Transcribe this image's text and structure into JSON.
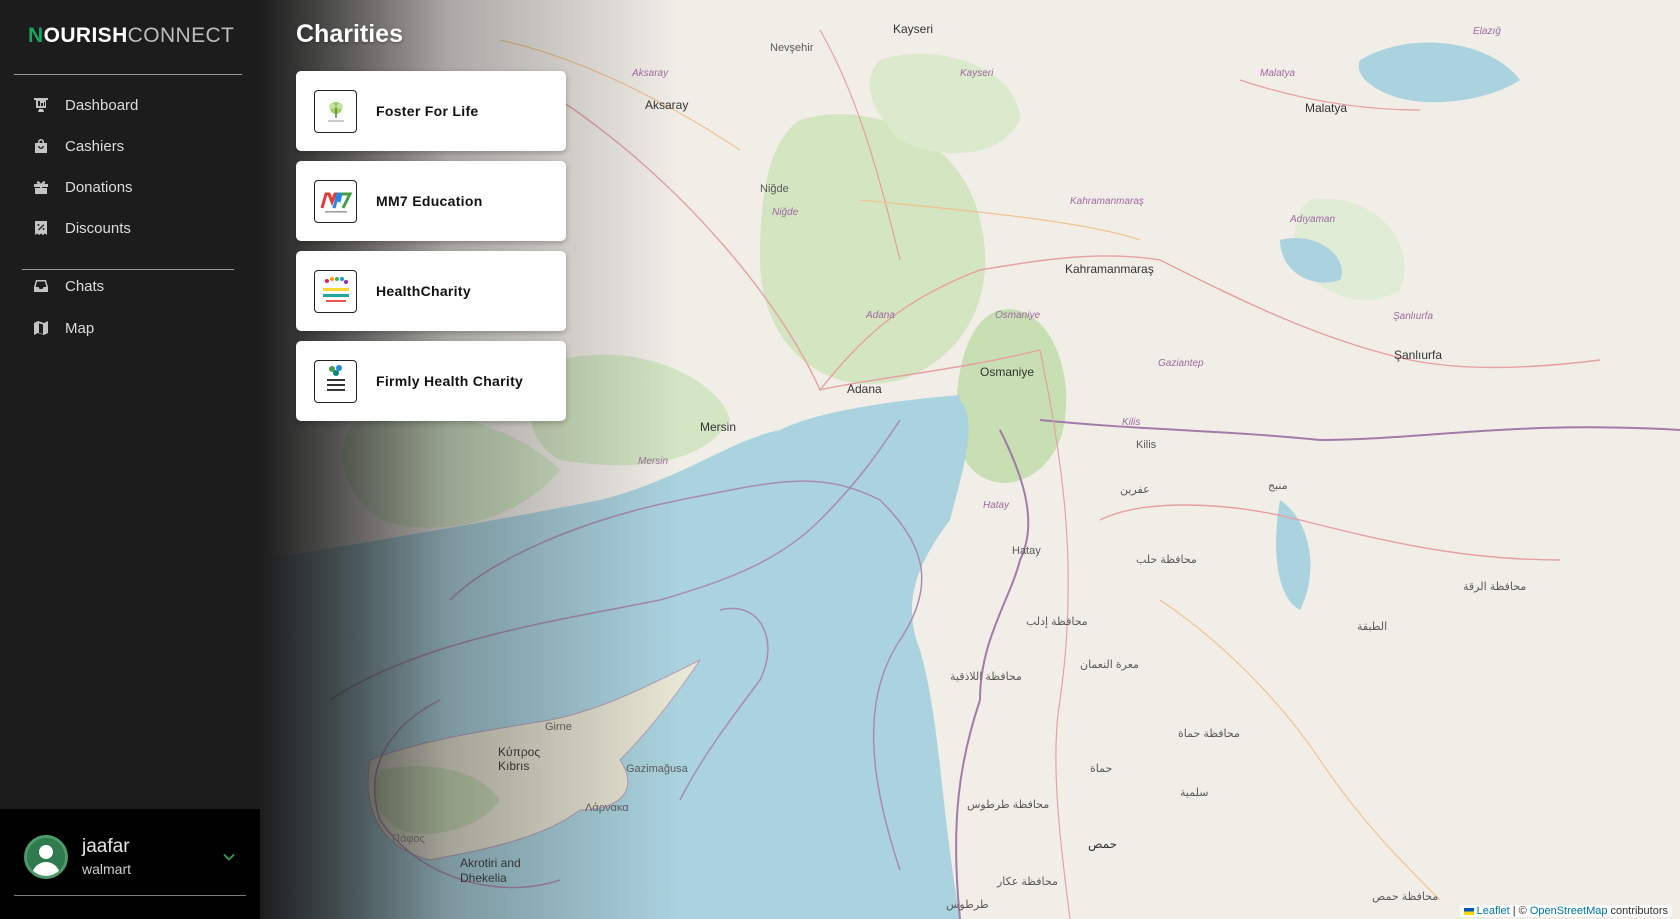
{
  "brand": {
    "first_letter": "N",
    "bold_part": "OURISH",
    "light_part": "CONNECT"
  },
  "sidebar": {
    "items": [
      {
        "label": "Dashboard",
        "icon": "dashboard-icon"
      },
      {
        "label": "Cashiers",
        "icon": "shopping-bag-icon"
      },
      {
        "label": "Donations",
        "icon": "gift-icon"
      },
      {
        "label": "Discounts",
        "icon": "receipt-percent-icon"
      },
      {
        "label": "Chats",
        "icon": "inbox-icon"
      },
      {
        "label": "Map",
        "icon": "map-icon"
      }
    ]
  },
  "user": {
    "name": "jaafar",
    "org": "walmart",
    "avatar_icon": "user-avatar-icon",
    "menu_icon": "chevron-down-icon"
  },
  "page": {
    "title": "Charities"
  },
  "charities": [
    {
      "name": "Foster For Life",
      "logo": "foster-for-life-logo"
    },
    {
      "name": "MM7 Education",
      "logo": "mm7-education-logo"
    },
    {
      "name": "HealthCharity",
      "logo": "healthcharity-logo"
    },
    {
      "name": "Firmly Health Charity",
      "logo": "firmly-health-charity-logo"
    }
  ],
  "map": {
    "labels": {
      "kayseri": "Kayseri",
      "kayseri_region": "Kayseri",
      "nevsehir": "Nevşehir",
      "aksaray": "Aksaray",
      "aksaray_region": "Aksaray",
      "nigde": "Niğde",
      "nigde_region": "Niğde",
      "malatya": "Malatya",
      "malatya_region": "Malatya",
      "elazig": "Elazığ",
      "kahramanmaras": "Kahramanmaraş",
      "kahramanmaras_region": "Kahramanmaraş",
      "adiyaman": "Adıyaman",
      "adana": "Adana",
      "adana_region": "Adana",
      "osmaniye": "Osmaniye",
      "osmaniye_region": "Osmaniye",
      "gaziantep": "Gaziantep",
      "sanliurfa": "Şanlıurfa",
      "sanliurfa_region": "Şanlıurfa",
      "mersin": "Mersin",
      "mersin_region": "Mersin",
      "kilis": "Kilis",
      "kilis_region": "Kilis",
      "hatay": "Hatay",
      "hatay_region": "Hatay",
      "girne": "Girne",
      "kibris": "Κύπρος\nKıbrıs",
      "gazimagusa": "Gazimağusa",
      "larnaka": "Λάρνακα",
      "pafos": "Πάφος",
      "akrotiri": "Akrotiri and\nDhekelia",
      "afrin": "عفرين",
      "manbij": "منبج",
      "aleppo": "محافظة حلب",
      "idlib": "محافظة إدلب",
      "maarat": "معرة النعمان",
      "latakia": "محافظة اللاذقية",
      "hama": "حماة",
      "hama_region": "محافظة حماة",
      "salamiyah": "سلمية",
      "tartus": "محافظة طرطوس",
      "homs": "حمص",
      "homs_region": "محافظة حمص",
      "raqqa": "محافظة الرقة",
      "tabqa": "الطبقة",
      "akkar": "محافظة عكار",
      "tartus_city": "طرطوس"
    }
  },
  "attribution": {
    "leaflet": "Leaflet",
    "separator": " | © ",
    "osm": "OpenStreetMap",
    "suffix": " contributors"
  }
}
